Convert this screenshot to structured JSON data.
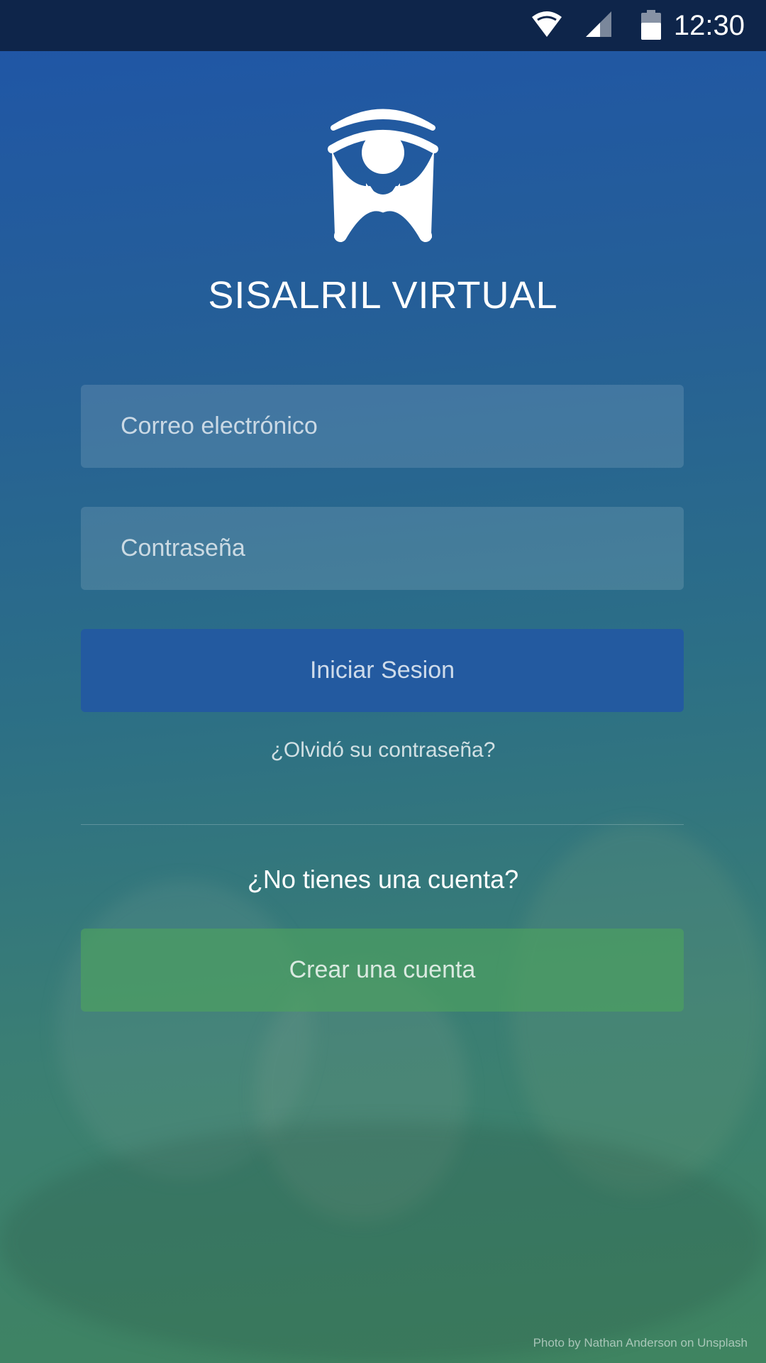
{
  "status_bar": {
    "time": "12:30",
    "icons": [
      "wifi-icon",
      "signal-icon",
      "battery-icon"
    ]
  },
  "app": {
    "logo": "sisalril-logo-icon",
    "title": "SISALRIL VIRTUAL"
  },
  "login_form": {
    "email_placeholder": "Correo electrónico",
    "password_placeholder": "Contraseña",
    "login_button": "Iniciar Sesion",
    "forgot_password_link": "¿Olvidó su contraseña?"
  },
  "signup": {
    "prompt": "¿No tienes una cuenta?",
    "create_button": "Crear una cuenta"
  },
  "photo_credit": "Photo by Nathan Anderson on Unsplash",
  "colors": {
    "status_bar": "#0e254a",
    "gradient_top": "#1f55a8",
    "gradient_bottom": "#3f8460",
    "login_button": "#235aa0",
    "create_button": "#4ca060"
  }
}
